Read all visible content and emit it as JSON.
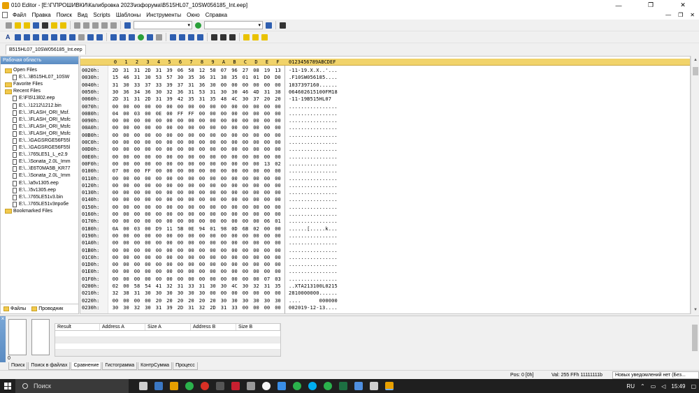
{
  "window": {
    "title": "010 Editor - [E:\\Г\\ПРОШИВКИ\\Калибровка 2023\\изфорума\\B515HL07_10SW056185_Int.eep]",
    "minimize": "—",
    "maximize": "❐",
    "close": "✕"
  },
  "menu": {
    "items": [
      "Файл",
      "Правка",
      "Поиск",
      "Вид",
      "Scripts",
      "Шаблоны",
      "Инструменты",
      "Окно",
      "Справка"
    ],
    "mdi_minimize": "—",
    "mdi_restore": "❐",
    "mdi_close": "✕"
  },
  "file_tab": "B515HL07_10SW056185_Int.eep",
  "left_panel": {
    "header": "Рабочая область",
    "open_files_label": "Open Files",
    "open_files": [
      "E:\\...\\B515HL07_10SW"
    ],
    "favorite_files_label": "Favorite Files",
    "recent_files_label": "Recent Files",
    "recent_files": [
      "E:\\F\\5\\13l02.eep",
      "E:\\...\\1212\\1212.bin",
      "E:\\...\\FLASH_ORI_Msf.",
      "E:\\...\\FLASH_ORI_Msfc",
      "E:\\...\\FLASH_ORI_Msfc",
      "E:\\...\\FLASH_ORI_Msfc",
      "E:\\...\\GAGSRGE56F55l",
      "E:\\...\\GAGSRGE56F55l",
      "E:\\...\\765LE51_L_e2.9",
      "E:\\...\\Sonata_2.0L_Imm",
      "E:\\...\\E6T0MA5B_KR77",
      "E:\\...\\Sonata_2.0L_Imm",
      "E:\\...\\a5v1305.eep",
      "E:\\...\\5v1305.eep",
      "E:\\...\\765LE51v3.bin",
      "E:\\...\\765LE51v3пробе"
    ],
    "bookmarked_files_label": "Bookmarked Files",
    "tabs": [
      "Файлы",
      "Проводник"
    ]
  },
  "hex": {
    "columns": [
      "0",
      "1",
      "2",
      "3",
      "4",
      "5",
      "6",
      "7",
      "8",
      "9",
      "A",
      "B",
      "C",
      "D",
      "E",
      "F"
    ],
    "ascii_header": "0123456789ABCDEF",
    "rows": [
      {
        "addr": "0020h:",
        "bytes": [
          "2D",
          "31",
          "31",
          "2D",
          "31",
          "39",
          "06",
          "58",
          "12",
          "58",
          "07",
          "96",
          "27",
          "08",
          "19",
          "13"
        ],
        "ascii": "-11-19.X.X..'..."
      },
      {
        "addr": "0030h:",
        "bytes": [
          "15",
          "46",
          "31",
          "30",
          "53",
          "57",
          "30",
          "35",
          "36",
          "31",
          "38",
          "35",
          "01",
          "01",
          "D0",
          "D0"
        ],
        "ascii": ".F10SW056185...."
      },
      {
        "addr": "0040h:",
        "bytes": [
          "31",
          "30",
          "33",
          "37",
          "33",
          "39",
          "37",
          "31",
          "36",
          "30",
          "00",
          "00",
          "00",
          "00",
          "00",
          "00"
        ],
        "ascii": "1037397160......"
      },
      {
        "addr": "0050h:",
        "bytes": [
          "30",
          "36",
          "34",
          "36",
          "30",
          "32",
          "36",
          "31",
          "53",
          "31",
          "30",
          "30",
          "46",
          "4D",
          "31",
          "38"
        ],
        "ascii": "064602615100FM18"
      },
      {
        "addr": "0060h:",
        "bytes": [
          "2D",
          "31",
          "31",
          "2D",
          "31",
          "39",
          "42",
          "35",
          "31",
          "35",
          "48",
          "4C",
          "30",
          "37",
          "20",
          "20"
        ],
        "ascii": "-11-19B515HL07  "
      },
      {
        "addr": "0070h:",
        "bytes": [
          "00",
          "00",
          "00",
          "00",
          "00",
          "00",
          "00",
          "00",
          "00",
          "00",
          "00",
          "00",
          "00",
          "00",
          "00",
          "00"
        ],
        "ascii": "................"
      },
      {
        "addr": "0080h:",
        "bytes": [
          "04",
          "00",
          "03",
          "00",
          "0E",
          "00",
          "FF",
          "FF",
          "00",
          "00",
          "00",
          "00",
          "00",
          "00",
          "00",
          "00"
        ],
        "ascii": "................"
      },
      {
        "addr": "0090h:",
        "bytes": [
          "00",
          "00",
          "00",
          "00",
          "00",
          "00",
          "00",
          "00",
          "00",
          "00",
          "00",
          "00",
          "00",
          "00",
          "00",
          "00"
        ],
        "ascii": "................"
      },
      {
        "addr": "00A0h:",
        "bytes": [
          "00",
          "00",
          "00",
          "00",
          "00",
          "00",
          "00",
          "00",
          "00",
          "00",
          "00",
          "00",
          "00",
          "00",
          "00",
          "00"
        ],
        "ascii": "................"
      },
      {
        "addr": "00B0h:",
        "bytes": [
          "00",
          "00",
          "00",
          "00",
          "00",
          "00",
          "00",
          "00",
          "00",
          "00",
          "00",
          "00",
          "00",
          "00",
          "00",
          "00"
        ],
        "ascii": "................"
      },
      {
        "addr": "00C0h:",
        "bytes": [
          "00",
          "00",
          "00",
          "00",
          "00",
          "00",
          "00",
          "00",
          "00",
          "00",
          "00",
          "00",
          "00",
          "00",
          "00",
          "00"
        ],
        "ascii": "................"
      },
      {
        "addr": "00D0h:",
        "bytes": [
          "00",
          "00",
          "00",
          "00",
          "00",
          "00",
          "00",
          "00",
          "00",
          "00",
          "00",
          "00",
          "00",
          "00",
          "00",
          "00"
        ],
        "ascii": "................"
      },
      {
        "addr": "00E0h:",
        "bytes": [
          "00",
          "00",
          "00",
          "00",
          "00",
          "00",
          "00",
          "00",
          "00",
          "00",
          "00",
          "00",
          "00",
          "00",
          "00",
          "00"
        ],
        "ascii": "................"
      },
      {
        "addr": "00F0h:",
        "bytes": [
          "00",
          "00",
          "00",
          "00",
          "00",
          "00",
          "00",
          "00",
          "00",
          "00",
          "00",
          "00",
          "00",
          "00",
          "13",
          "02"
        ],
        "ascii": "................"
      },
      {
        "addr": "0100h:",
        "bytes": [
          "07",
          "00",
          "00",
          "FF",
          "00",
          "00",
          "00",
          "00",
          "00",
          "00",
          "00",
          "00",
          "00",
          "00",
          "00",
          "00"
        ],
        "ascii": "................"
      },
      {
        "addr": "0110h:",
        "bytes": [
          "00",
          "00",
          "00",
          "00",
          "00",
          "00",
          "00",
          "00",
          "00",
          "00",
          "00",
          "00",
          "00",
          "00",
          "00",
          "00"
        ],
        "ascii": "................"
      },
      {
        "addr": "0120h:",
        "bytes": [
          "00",
          "00",
          "00",
          "00",
          "00",
          "00",
          "00",
          "00",
          "00",
          "00",
          "00",
          "00",
          "00",
          "00",
          "00",
          "00"
        ],
        "ascii": "................"
      },
      {
        "addr": "0130h:",
        "bytes": [
          "00",
          "00",
          "00",
          "00",
          "00",
          "00",
          "00",
          "00",
          "00",
          "00",
          "00",
          "00",
          "00",
          "00",
          "00",
          "00"
        ],
        "ascii": "................"
      },
      {
        "addr": "0140h:",
        "bytes": [
          "00",
          "00",
          "00",
          "00",
          "00",
          "00",
          "00",
          "00",
          "00",
          "00",
          "00",
          "00",
          "00",
          "00",
          "00",
          "00"
        ],
        "ascii": "................"
      },
      {
        "addr": "0150h:",
        "bytes": [
          "00",
          "00",
          "00",
          "00",
          "00",
          "00",
          "00",
          "00",
          "00",
          "00",
          "00",
          "00",
          "00",
          "00",
          "00",
          "00"
        ],
        "ascii": "................"
      },
      {
        "addr": "0160h:",
        "bytes": [
          "00",
          "00",
          "00",
          "00",
          "00",
          "00",
          "00",
          "00",
          "00",
          "00",
          "00",
          "00",
          "00",
          "00",
          "00",
          "00"
        ],
        "ascii": "................"
      },
      {
        "addr": "0170h:",
        "bytes": [
          "00",
          "00",
          "00",
          "00",
          "00",
          "00",
          "00",
          "00",
          "00",
          "00",
          "00",
          "00",
          "00",
          "00",
          "06",
          "01"
        ],
        "ascii": "................"
      },
      {
        "addr": "0180h:",
        "bytes": [
          "0A",
          "00",
          "03",
          "00",
          "D9",
          "11",
          "5B",
          "0E",
          "94",
          "01",
          "98",
          "0D",
          "6B",
          "02",
          "00",
          "00"
        ],
        "ascii": "......[.....k..."
      },
      {
        "addr": "0190h:",
        "bytes": [
          "00",
          "00",
          "00",
          "00",
          "00",
          "00",
          "00",
          "00",
          "00",
          "00",
          "00",
          "00",
          "00",
          "00",
          "00",
          "00"
        ],
        "ascii": "................"
      },
      {
        "addr": "01A0h:",
        "bytes": [
          "00",
          "00",
          "00",
          "00",
          "00",
          "00",
          "00",
          "00",
          "00",
          "00",
          "00",
          "00",
          "00",
          "00",
          "00",
          "00"
        ],
        "ascii": "................"
      },
      {
        "addr": "01B0h:",
        "bytes": [
          "00",
          "00",
          "00",
          "00",
          "00",
          "00",
          "00",
          "00",
          "00",
          "00",
          "00",
          "00",
          "00",
          "00",
          "00",
          "00"
        ],
        "ascii": "................"
      },
      {
        "addr": "01C0h:",
        "bytes": [
          "00",
          "00",
          "00",
          "00",
          "00",
          "00",
          "00",
          "00",
          "00",
          "00",
          "00",
          "00",
          "00",
          "00",
          "00",
          "00"
        ],
        "ascii": "................"
      },
      {
        "addr": "01D0h:",
        "bytes": [
          "00",
          "00",
          "00",
          "00",
          "00",
          "00",
          "00",
          "00",
          "00",
          "00",
          "00",
          "00",
          "00",
          "00",
          "00",
          "00"
        ],
        "ascii": "................"
      },
      {
        "addr": "01E0h:",
        "bytes": [
          "00",
          "00",
          "00",
          "00",
          "00",
          "00",
          "00",
          "00",
          "00",
          "00",
          "00",
          "00",
          "00",
          "00",
          "00",
          "00"
        ],
        "ascii": "................"
      },
      {
        "addr": "01F0h:",
        "bytes": [
          "00",
          "00",
          "00",
          "00",
          "00",
          "00",
          "00",
          "00",
          "00",
          "00",
          "00",
          "00",
          "00",
          "00",
          "07",
          "03"
        ],
        "ascii": "................"
      },
      {
        "addr": "0200h:",
        "bytes": [
          "02",
          "00",
          "58",
          "54",
          "41",
          "32",
          "31",
          "33",
          "31",
          "30",
          "30",
          "4C",
          "30",
          "32",
          "31",
          "35"
        ],
        "ascii": "..XTA213100L0215"
      },
      {
        "addr": "0210h:",
        "bytes": [
          "32",
          "38",
          "31",
          "30",
          "30",
          "30",
          "30",
          "30",
          "30",
          "00",
          "00",
          "00",
          "00",
          "00",
          "00",
          "00"
        ],
        "ascii": "2810000000......"
      },
      {
        "addr": "0220h:",
        "bytes": [
          "00",
          "00",
          "00",
          "00",
          "20",
          "20",
          "20",
          "20",
          "20",
          "20",
          "30",
          "30",
          "30",
          "30",
          "30",
          "30"
        ],
        "ascii": "....      000000"
      },
      {
        "addr": "0230h:",
        "bytes": [
          "30",
          "30",
          "32",
          "30",
          "31",
          "39",
          "2D",
          "31",
          "32",
          "2D",
          "31",
          "33",
          "00",
          "00",
          "00",
          "00"
        ],
        "ascii": "002019-12-13...."
      }
    ]
  },
  "results": {
    "columns": [
      "Result",
      "Address A",
      "Size A",
      "Address B",
      "Size B"
    ],
    "side_label": "Вывод",
    "zero": "0"
  },
  "bottom_tabs": [
    "Поиск",
    "Поиск в файлах",
    "Сравнение",
    "Гистограмма",
    "КонтрСумма",
    "Процесс"
  ],
  "status": {
    "pos": "Pos: 0 [0h]",
    "val": "Val: 255 FFh 11111111b",
    "notification": "Новых уведомлений нет (Без..."
  },
  "taskbar": {
    "search_placeholder": "Поиск",
    "lang": "RU",
    "time": "15:49"
  },
  "colors": {
    "hex_header": "#f1d36a",
    "panel_header": "#5a8bc2",
    "taskbar": "#1f1f1f"
  }
}
